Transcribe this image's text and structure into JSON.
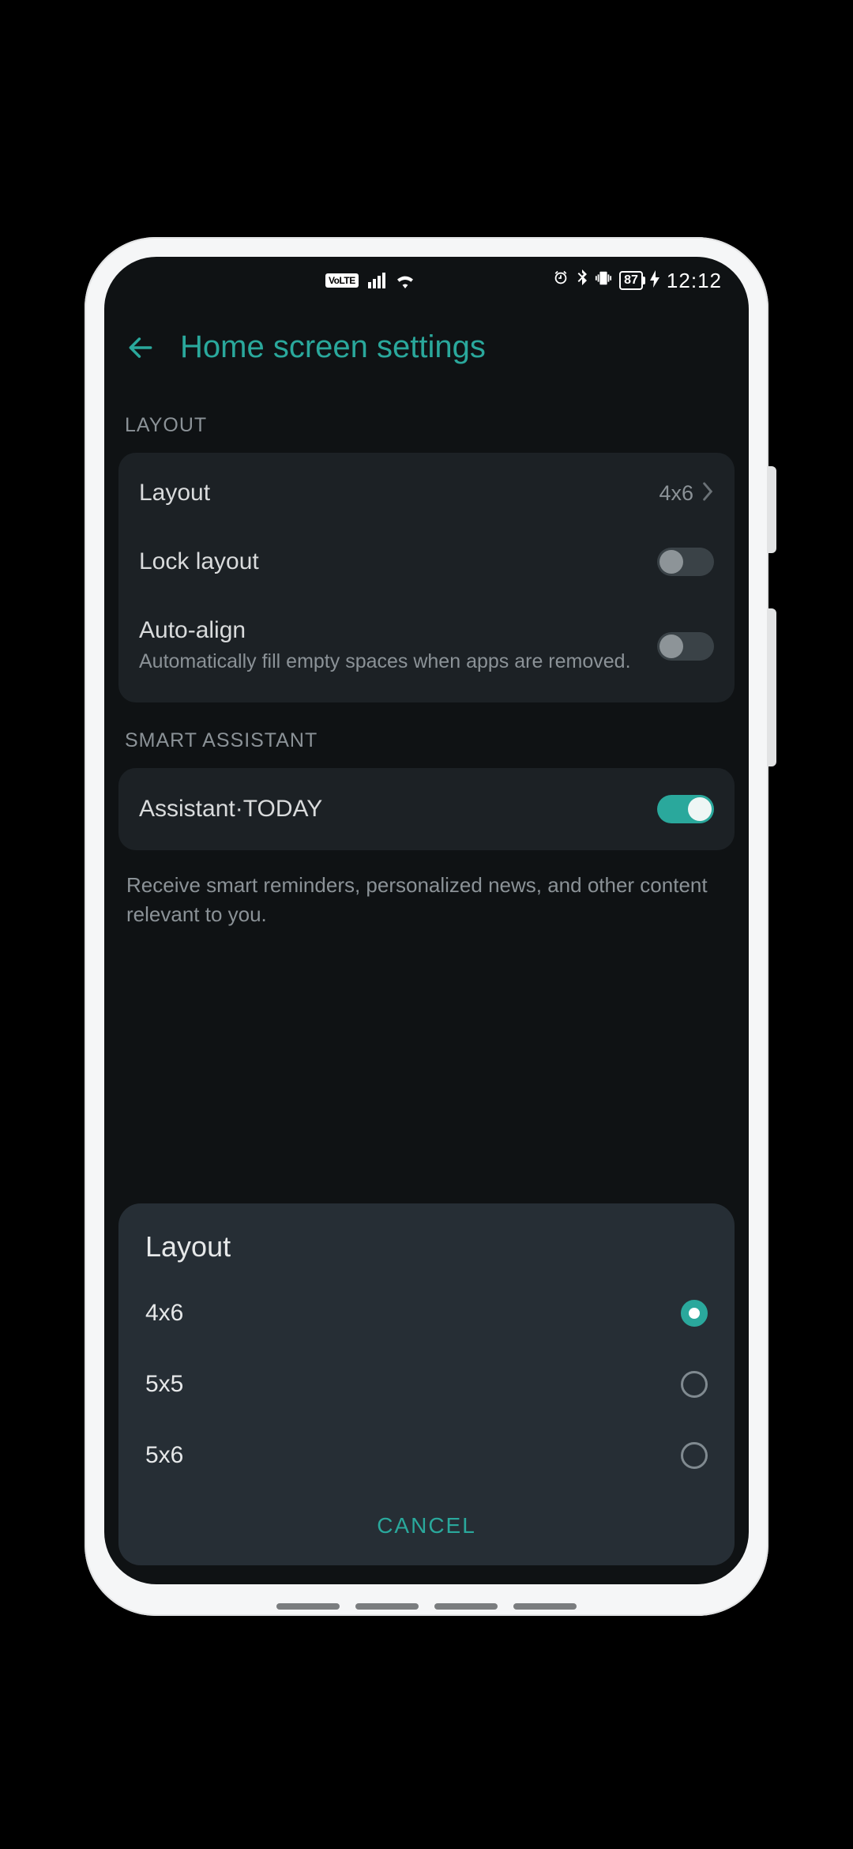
{
  "statusbar": {
    "volte": "VoLTE",
    "battery_pct": "87",
    "time": "12:12"
  },
  "header": {
    "title": "Home screen settings"
  },
  "sections": {
    "layout_label": "LAYOUT",
    "smart_label": "SMART ASSISTANT"
  },
  "rows": {
    "layout": {
      "title": "Layout",
      "value": "4x6"
    },
    "lock": {
      "title": "Lock layout",
      "on": false
    },
    "align": {
      "title": "Auto-align",
      "sub": "Automatically fill empty spaces when apps are removed.",
      "on": false
    },
    "assistant": {
      "title": "Assistant·TODAY",
      "on": true
    },
    "assistant_note": "Receive smart reminders, personalized news, and other content relevant to you."
  },
  "dialog": {
    "title": "Layout",
    "options": [
      {
        "label": "4x6",
        "checked": true
      },
      {
        "label": "5x5",
        "checked": false
      },
      {
        "label": "5x6",
        "checked": false
      }
    ],
    "cancel": "CANCEL"
  }
}
